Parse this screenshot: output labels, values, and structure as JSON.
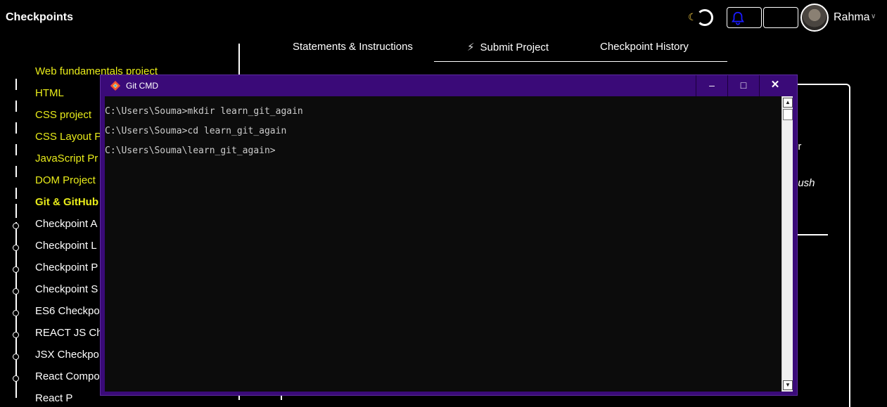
{
  "header": {
    "title": "Checkpoints",
    "username": "Rahma",
    "moon_glyph": "☾",
    "chevron_glyph": "∨"
  },
  "tabs": [
    {
      "label": "Statements & Instructions"
    },
    {
      "label": "Submit Project",
      "icon": "lightning-icon"
    },
    {
      "label": "Checkpoint History"
    }
  ],
  "sidebar": {
    "items": [
      {
        "label": "Web fundamentals project",
        "status": "done"
      },
      {
        "label": "HTML",
        "status": "done"
      },
      {
        "label": "CSS project",
        "status": "done"
      },
      {
        "label": "CSS Layout P",
        "status": "done"
      },
      {
        "label": "JavaScript Pr",
        "status": "done"
      },
      {
        "label": "DOM Project",
        "status": "done"
      },
      {
        "label": "Git & GitHub",
        "status": "current"
      },
      {
        "label": "Checkpoint A",
        "status": "todo"
      },
      {
        "label": "Checkpoint L",
        "status": "todo"
      },
      {
        "label": "Checkpoint P",
        "status": "todo"
      },
      {
        "label": "Checkpoint S",
        "status": "todo"
      },
      {
        "label": "ES6 Checkpo",
        "status": "todo"
      },
      {
        "label": "REACT JS Ch",
        "status": "todo"
      },
      {
        "label": "JSX Checkpo",
        "status": "todo"
      },
      {
        "label": "React Compo",
        "status": "todo"
      },
      {
        "label": "React P",
        "status": "todo"
      }
    ]
  },
  "content": {
    "fragment1": "ur",
    "fragment2": "push"
  },
  "terminal": {
    "title": "Git CMD",
    "minimize_glyph": "–",
    "maximize_glyph": "□",
    "close_glyph": "✕",
    "scroll_up_glyph": "▲",
    "scroll_down_glyph": "▼",
    "lines": [
      "C:\\Users\\Souma>mkdir learn_git_again",
      "C:\\Users\\Souma>cd learn_git_again",
      "C:\\Users\\Souma\\learn_git_again>"
    ]
  },
  "colors": {
    "done": "#e9ec1a",
    "terminal_frame": "#3a0a78",
    "bell": "#1a1aff"
  }
}
